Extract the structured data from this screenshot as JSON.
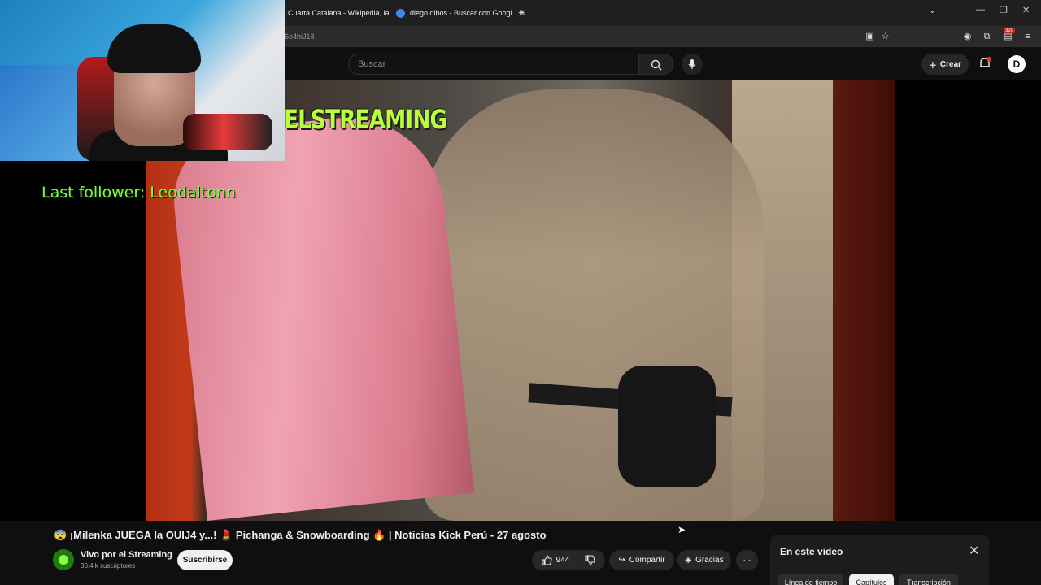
{
  "browser": {
    "tabs": [
      {
        "label": "Cuarta Catalana - Wikipedia, la",
        "favicon_color": "#e0e0e0"
      },
      {
        "label": "diego dibos - Buscar con Googl",
        "favicon_color": "#4285f4"
      }
    ],
    "url": "6o4hiJ18",
    "extension_badge": "320"
  },
  "youtube_header": {
    "search_placeholder": "Buscar",
    "create_label": "Crear",
    "avatar_letter": "D"
  },
  "stream_overlay": {
    "brand_text": "ELSTREAMING",
    "last_follower": "Last follower: Leodaltonn"
  },
  "video": {
    "title_emoji_left": "😨",
    "title": "¡Milenka JUEGA la OUIJ4 y...! 💄 Pichanga & Snowboarding 🔥 | Noticias Kick Perú - 27 agosto"
  },
  "channel": {
    "name": "Vivo por el Streaming",
    "subscribers": "36.4 k suscriptores",
    "subscribe_label": "Suscribirse"
  },
  "actions": {
    "likes": "944",
    "share_label": "Compartir",
    "thanks_label": "Gracias",
    "more_label": "···"
  },
  "side_panel": {
    "title": "En este video",
    "chips": [
      {
        "label": "Línea de tiempo",
        "active": false
      },
      {
        "label": "Capítulos",
        "active": true
      },
      {
        "label": "Transcripción",
        "active": false
      }
    ]
  },
  "colors": {
    "brand_green": "#b8ff3a",
    "follower_green": "#7cff3e",
    "yt_bg": "#0f0f0f"
  }
}
